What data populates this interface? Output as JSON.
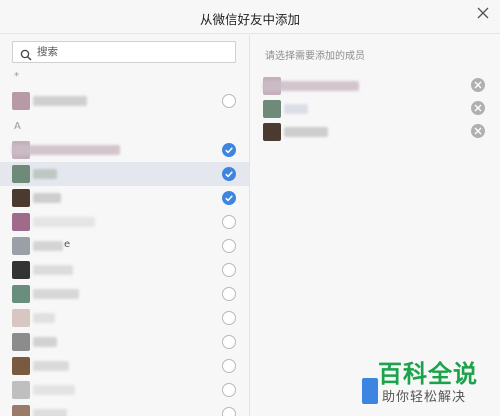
{
  "dialog": {
    "title": "从微信好友中添加"
  },
  "search": {
    "placeholder": "搜索"
  },
  "sections": [
    "*",
    "A"
  ],
  "contacts": [
    {
      "avatar_color": "#b89aa6",
      "blur_color": "#c9c9c9",
      "checked": false,
      "suffix": ""
    },
    {
      "avatar_color": "#c4b0bc",
      "blur_color": "#cdbdc6",
      "checked": true,
      "suffix": ""
    },
    {
      "avatar_color": "#6f8a78",
      "blur_color": "#d5dbe2",
      "checked": true,
      "suffix": ""
    },
    {
      "avatar_color": "#4a3a30",
      "blur_color": "#c7c7c7",
      "checked": true,
      "suffix": ""
    },
    {
      "avatar_color": "#a06a8a",
      "blur_color": "#e2e2e2",
      "checked": false,
      "suffix": ""
    },
    {
      "avatar_color": "#9aa0a6",
      "blur_color": "#cfcfcf",
      "checked": false,
      "suffix": "e"
    },
    {
      "avatar_color": "#333333",
      "blur_color": "#d8d8d8",
      "checked": false,
      "suffix": ""
    },
    {
      "avatar_color": "#6a8e7e",
      "blur_color": "#d2d2d2",
      "checked": false,
      "suffix": ""
    },
    {
      "avatar_color": "#d8c6c2",
      "blur_color": "#dedede",
      "checked": false,
      "suffix": ""
    },
    {
      "avatar_color": "#8c8c8c",
      "blur_color": "#cccccc",
      "checked": false,
      "suffix": ""
    },
    {
      "avatar_color": "#7a5a3e",
      "blur_color": "#d6d6d6",
      "checked": false,
      "suffix": ""
    },
    {
      "avatar_color": "#bfbfbf",
      "blur_color": "#e0e0e0",
      "checked": false,
      "suffix": ""
    }
  ],
  "selected_panel": {
    "heading": "请选择需要添加的成员",
    "members": [
      {
        "avatar_color": "#c4b0bc",
        "blur_color": "#cdbdc6"
      },
      {
        "avatar_color": "#6f8a78",
        "blur_color": "#d5dbe2"
      },
      {
        "avatar_color": "#4a3a30",
        "blur_color": "#c7c7c7"
      }
    ]
  },
  "colors": {
    "accent": "#3d85e0",
    "selected_row": "#e4e8ee",
    "watermark_green": "#1aa34a"
  },
  "watermark": {
    "logo": "百科全说",
    "sub": "助你轻松解决"
  }
}
